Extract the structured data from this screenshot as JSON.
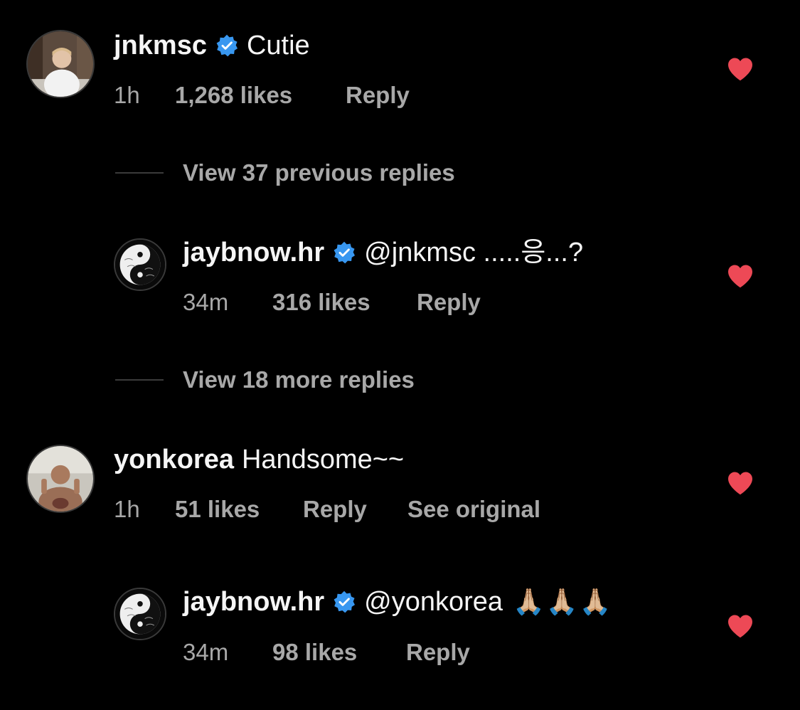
{
  "comments": [
    {
      "username": "jnkmsc",
      "verified": true,
      "text": "Cutie",
      "time": "1h",
      "likes": "1,268 likes",
      "reply": "Reply",
      "liked": true
    },
    {
      "username": "jaybnow.hr",
      "verified": true,
      "text": "@jnkmsc .....응...?",
      "time": "34m",
      "likes": "316 likes",
      "reply": "Reply",
      "liked": true
    },
    {
      "username": "yonkorea",
      "verified": false,
      "text": "Handsome~~",
      "time": "1h",
      "likes": "51 likes",
      "reply": "Reply",
      "see_original": "See original",
      "liked": true
    },
    {
      "username": "jaybnow.hr",
      "verified": true,
      "text": "@yonkorea",
      "emoji": "🙏🏼🙏🏼🙏🏼",
      "time": "34m",
      "likes": "98 likes",
      "reply": "Reply",
      "liked": true
    }
  ],
  "view_replies": [
    {
      "label": "View 37 previous replies"
    },
    {
      "label": "View 18 more replies"
    }
  ],
  "icons": {
    "verified_badge": "verified-badge-icon",
    "like": "heart-icon"
  },
  "colors": {
    "background": "#000000",
    "primary_text": "#f5f5f5",
    "secondary_text": "#a8a8a8",
    "verified_blue": "#3897f0",
    "heart_red": "#ed4956"
  }
}
